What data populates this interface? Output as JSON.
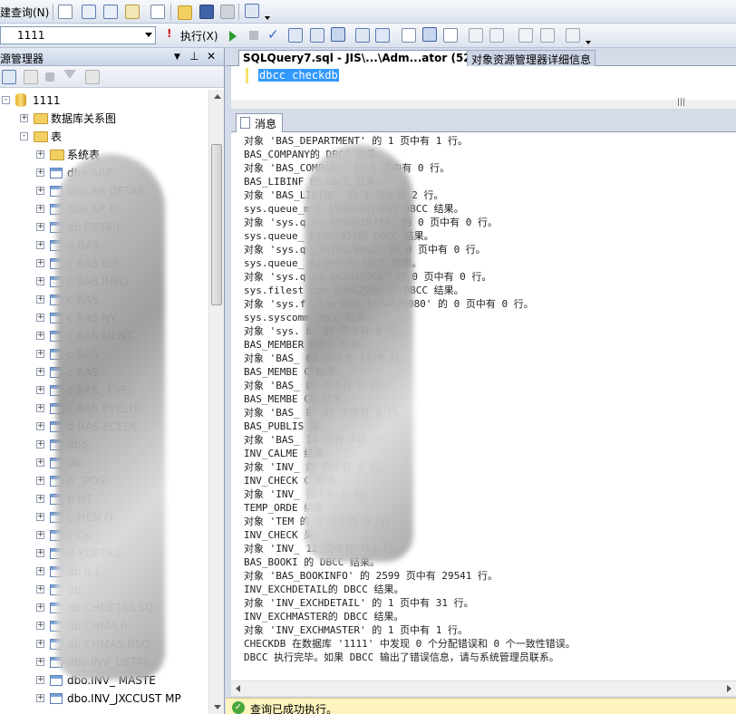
{
  "toolbar": {
    "new_query": "建查询(N)",
    "database": "1111",
    "execute": "执行(X)"
  },
  "left_panel": {
    "title": "源管理器",
    "tree": [
      {
        "label": "1111",
        "kind": "db",
        "level": 0,
        "expander": "-"
      },
      {
        "label": "数据库关系图",
        "kind": "folder",
        "level": 1,
        "expander": "+"
      },
      {
        "label": "表",
        "kind": "folder",
        "level": 1,
        "expander": "-"
      },
      {
        "label": "系统表",
        "kind": "folder",
        "level": 2,
        "expander": "+"
      },
      {
        "label": "dbo.ARP",
        "kind": "table",
        "level": 2,
        "expander": "+"
      },
      {
        "label": "dbo.AR   DETAIL",
        "kind": "table",
        "level": 2,
        "expander": "+"
      },
      {
        "label": "dbo.AR   E",
        "kind": "table",
        "level": 2,
        "expander": "+"
      },
      {
        "label": "db   DETAIL",
        "kind": "table",
        "level": 2,
        "expander": "+"
      },
      {
        "label": "d  BAS",
        "kind": "table",
        "level": 2,
        "expander": "+"
      },
      {
        "label": "c  BAS   BIP",
        "kind": "table",
        "level": 2,
        "expander": "+"
      },
      {
        "label": "c  BAS   INFO",
        "kind": "table",
        "level": 2,
        "expander": "+"
      },
      {
        "label": "c  BAS",
        "kind": "table",
        "level": 2,
        "expander": "+"
      },
      {
        "label": "c  BAS   NY",
        "kind": "table",
        "level": 2,
        "expander": "+"
      },
      {
        "label": "c  BAS   MENT",
        "kind": "table",
        "level": 2,
        "expander": "+"
      },
      {
        "label": "c  BAS",
        "kind": "table",
        "level": 2,
        "expander": "+"
      },
      {
        "label": "c  BAS",
        "kind": "table",
        "level": 2,
        "expander": "+"
      },
      {
        "label": "c  BAS_   EVEL",
        "kind": "table",
        "level": 2,
        "expander": "+"
      },
      {
        "label": "c  BAS   EVELHI",
        "kind": "table",
        "level": 2,
        "expander": "+"
      },
      {
        "label": "d  BAS   ECEDE",
        "kind": "table",
        "level": 2,
        "expander": "+"
      },
      {
        "label": "dbo.",
        "kind": "table",
        "level": 2,
        "expander": "+"
      },
      {
        "label": "db",
        "kind": "table",
        "level": 2,
        "expander": "+"
      },
      {
        "label": "b   _POSI",
        "kind": "table",
        "level": 2,
        "expander": "+"
      },
      {
        "label": "b   NT",
        "kind": "table",
        "level": 2,
        "expander": "+"
      },
      {
        "label": "c   MEN  O",
        "kind": "table",
        "level": 2,
        "expander": "+"
      },
      {
        "label": "c   CK",
        "kind": "table",
        "level": 2,
        "expander": "+"
      },
      {
        "label": "d   XDETAIL",
        "kind": "table",
        "level": 2,
        "expander": "+"
      },
      {
        "label": "db   IL1",
        "kind": "table",
        "level": 2,
        "expander": "+"
      },
      {
        "label": "db",
        "kind": "table",
        "level": 2,
        "expander": "+"
      },
      {
        "label": "db   CHDETAILSQ",
        "kind": "table",
        "level": 2,
        "expander": "+"
      },
      {
        "label": "db   CHMA  R",
        "kind": "table",
        "level": 2,
        "expander": "+"
      },
      {
        "label": "db   CHMAS  RSQ",
        "kind": "table",
        "level": 2,
        "expander": "+"
      },
      {
        "label": "dbo.INV_DETAIL",
        "kind": "table",
        "level": 2,
        "expander": "+"
      },
      {
        "label": "dbo.INV_ MASTE",
        "kind": "table",
        "level": 2,
        "expander": "+"
      },
      {
        "label": "dbo.INV_JXCCUST  MP",
        "kind": "table",
        "level": 2,
        "expander": "+"
      }
    ]
  },
  "doc_tabs": {
    "active": "SQLQuery7.sql - JIS\\...\\Adm...ator (52))*",
    "other": "对象资源管理器详细信息"
  },
  "editor": {
    "code": "dbcc checkdb"
  },
  "results": {
    "tab": "消息",
    "lines": [
      "对象 'BAS_DEPARTMENT' 的 1 页中有 1 行。",
      "BAS_COMPANY的 DBCC 结果。",
      "对象 'BAS_COMPANY' 的 0 页中有 0 行。",
      "BAS_LIBINF 的 DBCC 结果。",
      "对象 'BAS_LIBINF' 的 1 页中有 2 行。",
      "sys.queue_m   s_1598628738的 DBCC 结果。",
      "对象 'sys.q   es_1598628738' 的 0 页中有 0 行。",
      "sys.queue_   62862852的 DBCC 结果。",
      "对象 'sys.q   _1630628852' 的 0 页中有 0 行。",
      "sys.queue_   628966的 DBCC 结果。",
      "对象 'sys.q   ge   662628966' 的 0 页中有 0 行。",
      "sys.filest   con   694629080的 DBCC 结果。",
      "对象 'sys.f   _tom   one_1694629080' 的 0 页中有 0 行。",
      "sys.syscomm   DBCC 结果。",
      "对象 'sys.   b' 的   页中有 0 行。",
      "BAS_MEMBER   DBCC 结果。",
      "对象 'BAS_   63 页中有 1378 行。",
      "BAS_MEMBE   C 结果。",
      "对象 'BAS_   的   页中有 0 行。",
      "BAS_MEMBE   CC 结果。",
      "对象 'BAS_   E' 的   页中有 0 行。",
      "BAS_PUBLIS   果。",
      "对象 'BAS_   14   中有 746 行。",
      "INV_CALME   结果",
      "对象 'INV_   的   页中有 0 行。",
      "INV_CHECK   C 结果",
      "对象 'INV_   页中有 0 行。",
      "TEMP_ORDE   结果",
      "对象 'TEM   的 0 页中有 0 行。",
      "INV_CHECK   果。",
      "对象 'INV_   12 页中有 351 行。",
      "BAS_BOOKI   的 DBCC 结果。",
      "对象 'BAS_BOOKINFO' 的 2599 页中有 29541 行。",
      "INV_EXCHDETAIL的 DBCC 结果。",
      "对象 'INV_EXCHDETAIL' 的 1 页中有 31 行。",
      "INV_EXCHMASTER的 DBCC 结果。",
      "对象 'INV_EXCHMASTER' 的 1 页中有 1 行。",
      "CHECKDB 在数据库 '1111' 中发现 0 个分配错误和 0 个一致性错误。",
      "DBCC 执行完毕。如果 DBCC 输出了错误信息，请与系统管理员联系。"
    ]
  },
  "status": {
    "text": "查询已成功执行。"
  }
}
